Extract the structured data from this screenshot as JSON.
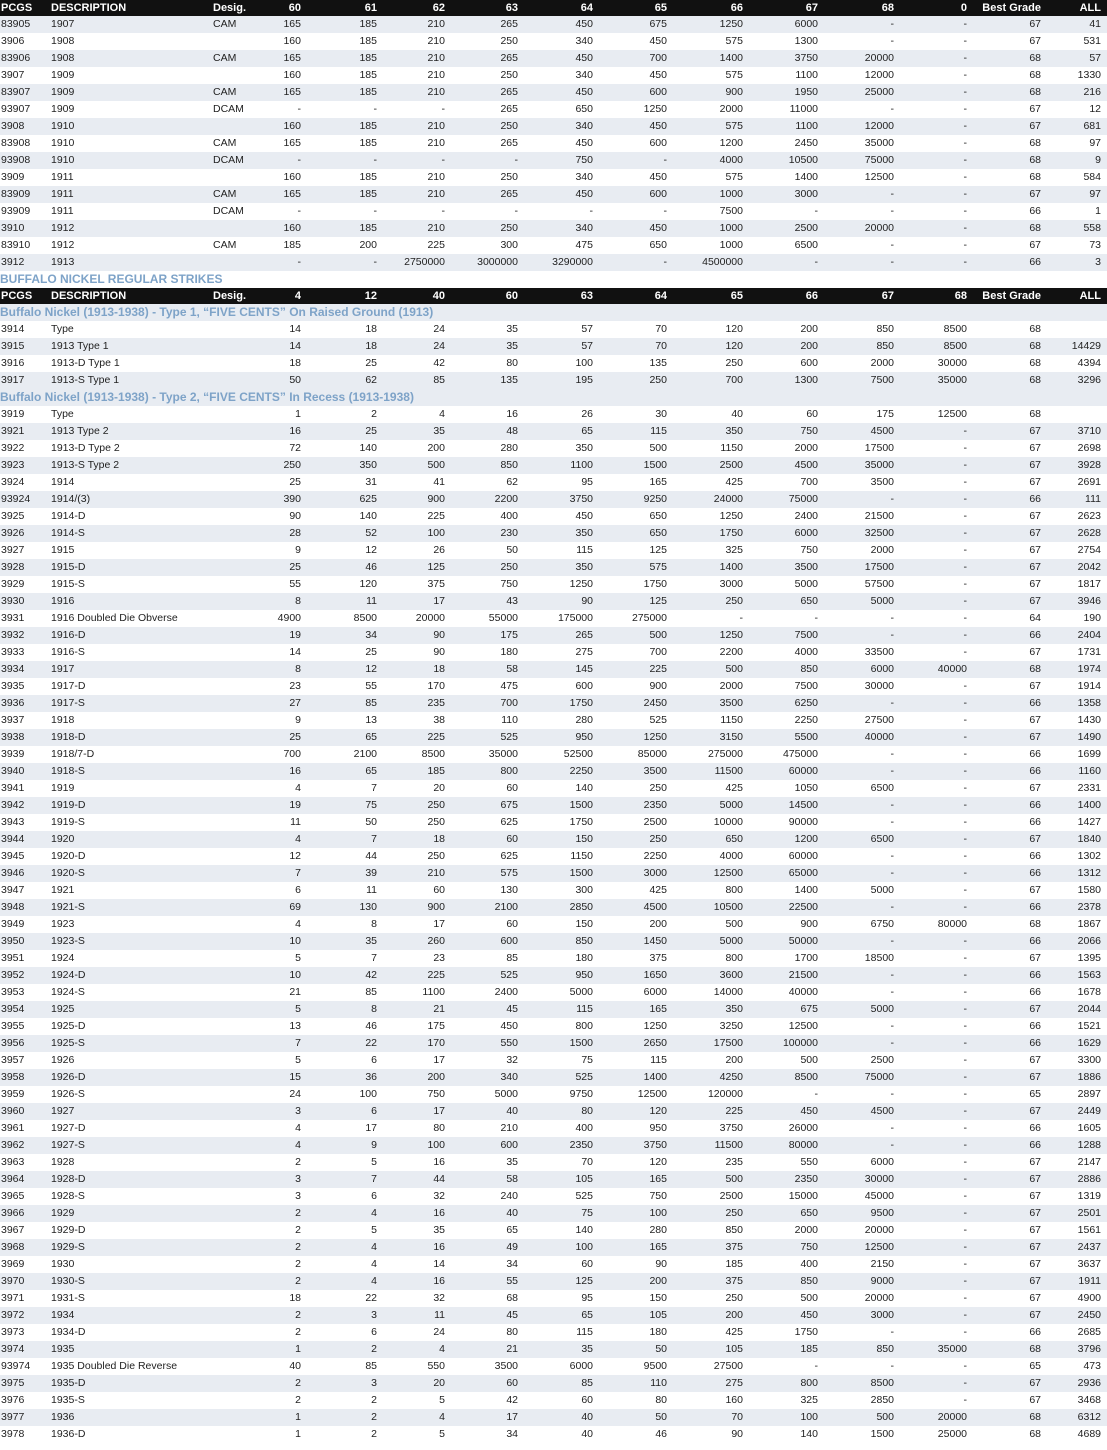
{
  "header1": {
    "pcgs": "PCGS",
    "desc": "DESCRIPTION",
    "desig": "Desig.",
    "g": [
      "60",
      "61",
      "62",
      "63",
      "64",
      "65",
      "66",
      "67",
      "68",
      "0"
    ],
    "best": "Best Grade",
    "all": "ALL"
  },
  "rows1": [
    [
      "83905",
      "1907",
      "CAM",
      "165",
      "185",
      "210",
      "265",
      "450",
      "675",
      "1250",
      "6000",
      "-",
      "-",
      "67",
      "41"
    ],
    [
      "3906",
      "1908",
      "",
      "160",
      "185",
      "210",
      "250",
      "340",
      "450",
      "575",
      "1300",
      "-",
      "-",
      "67",
      "531"
    ],
    [
      "83906",
      "1908",
      "CAM",
      "165",
      "185",
      "210",
      "265",
      "450",
      "700",
      "1400",
      "3750",
      "20000",
      "-",
      "68",
      "57"
    ],
    [
      "3907",
      "1909",
      "",
      "160",
      "185",
      "210",
      "250",
      "340",
      "450",
      "575",
      "1100",
      "12000",
      "-",
      "68",
      "1330"
    ],
    [
      "83907",
      "1909",
      "CAM",
      "165",
      "185",
      "210",
      "265",
      "450",
      "600",
      "900",
      "1950",
      "25000",
      "-",
      "68",
      "216"
    ],
    [
      "93907",
      "1909",
      "DCAM",
      "-",
      "-",
      "-",
      "265",
      "650",
      "1250",
      "2000",
      "11000",
      "-",
      "-",
      "67",
      "12"
    ],
    [
      "3908",
      "1910",
      "",
      "160",
      "185",
      "210",
      "250",
      "340",
      "450",
      "575",
      "1100",
      "12000",
      "-",
      "67",
      "681"
    ],
    [
      "83908",
      "1910",
      "CAM",
      "165",
      "185",
      "210",
      "265",
      "450",
      "600",
      "1200",
      "2450",
      "35000",
      "-",
      "68",
      "97"
    ],
    [
      "93908",
      "1910",
      "DCAM",
      "-",
      "-",
      "-",
      "-",
      "750",
      "-",
      "4000",
      "10500",
      "75000",
      "-",
      "68",
      "9"
    ],
    [
      "3909",
      "1911",
      "",
      "160",
      "185",
      "210",
      "250",
      "340",
      "450",
      "575",
      "1400",
      "12500",
      "-",
      "68",
      "584"
    ],
    [
      "83909",
      "1911",
      "CAM",
      "165",
      "185",
      "210",
      "265",
      "450",
      "600",
      "1000",
      "3000",
      "-",
      "-",
      "67",
      "97"
    ],
    [
      "93909",
      "1911",
      "DCAM",
      "-",
      "-",
      "-",
      "-",
      "-",
      "-",
      "7500",
      "-",
      "-",
      "-",
      "66",
      "1"
    ],
    [
      "3910",
      "1912",
      "",
      "160",
      "185",
      "210",
      "250",
      "340",
      "450",
      "1000",
      "2500",
      "20000",
      "-",
      "68",
      "558"
    ],
    [
      "83910",
      "1912",
      "CAM",
      "185",
      "200",
      "225",
      "300",
      "475",
      "650",
      "1000",
      "6500",
      "-",
      "-",
      "67",
      "73"
    ],
    [
      "3912",
      "1913",
      "",
      "-",
      "-",
      "2750000",
      "3000000",
      "3290000",
      "-",
      "4500000",
      "-",
      "-",
      "-",
      "66",
      "3"
    ]
  ],
  "section_title": "BUFFALO NICKEL REGULAR STRIKES",
  "header2": {
    "pcgs": "PCGS",
    "desc": "DESCRIPTION",
    "desig": "Desig.",
    "g": [
      "4",
      "12",
      "40",
      "60",
      "63",
      "64",
      "65",
      "66",
      "67",
      "68"
    ],
    "best": "Best Grade",
    "all": "ALL"
  },
  "sub1": "Buffalo Nickel (1913-1938) - Type 1, “FIVE CENTS” On Raised Ground  (1913)",
  "rows2": [
    [
      "3914",
      "Type",
      "",
      "14",
      "18",
      "24",
      "35",
      "57",
      "70",
      "120",
      "200",
      "850",
      "8500",
      "68",
      ""
    ],
    [
      "3915",
      "1913  Type 1",
      "",
      "14",
      "18",
      "24",
      "35",
      "57",
      "70",
      "120",
      "200",
      "850",
      "8500",
      "68",
      "14429"
    ],
    [
      "3916",
      "1913-D  Type 1",
      "",
      "18",
      "25",
      "42",
      "80",
      "100",
      "135",
      "250",
      "600",
      "2000",
      "30000",
      "68",
      "4394"
    ],
    [
      "3917",
      "1913-S  Type 1",
      "",
      "50",
      "62",
      "85",
      "135",
      "195",
      "250",
      "700",
      "1300",
      "7500",
      "35000",
      "68",
      "3296"
    ]
  ],
  "sub2": "Buffalo Nickel (1913-1938) - Type 2, “FIVE CENTS” In Recess  (1913-1938)",
  "rows3": [
    [
      "3919",
      "Type",
      "",
      "1",
      "2",
      "4",
      "16",
      "26",
      "30",
      "40",
      "60",
      "175",
      "12500",
      "68",
      ""
    ],
    [
      "3921",
      "1913  Type 2",
      "",
      "16",
      "25",
      "35",
      "48",
      "65",
      "115",
      "350",
      "750",
      "4500",
      "-",
      "67",
      "3710"
    ],
    [
      "3922",
      "1913-D  Type 2",
      "",
      "72",
      "140",
      "200",
      "280",
      "350",
      "500",
      "1150",
      "2000",
      "17500",
      "-",
      "67",
      "2698"
    ],
    [
      "3923",
      "1913-S  Type 2",
      "",
      "250",
      "350",
      "500",
      "850",
      "1100",
      "1500",
      "2500",
      "4500",
      "35000",
      "-",
      "67",
      "3928"
    ],
    [
      "3924",
      "1914",
      "",
      "25",
      "31",
      "41",
      "62",
      "95",
      "165",
      "425",
      "700",
      "3500",
      "-",
      "67",
      "2691"
    ],
    [
      "93924",
      "1914/(3)",
      "",
      "390",
      "625",
      "900",
      "2200",
      "3750",
      "9250",
      "24000",
      "75000",
      "-",
      "-",
      "66",
      "111"
    ],
    [
      "3925",
      "1914-D",
      "",
      "90",
      "140",
      "225",
      "400",
      "450",
      "650",
      "1250",
      "2400",
      "21500",
      "-",
      "67",
      "2623"
    ],
    [
      "3926",
      "1914-S",
      "",
      "28",
      "52",
      "100",
      "230",
      "350",
      "650",
      "1750",
      "6000",
      "32500",
      "-",
      "67",
      "2628"
    ],
    [
      "3927",
      "1915",
      "",
      "9",
      "12",
      "26",
      "50",
      "115",
      "125",
      "325",
      "750",
      "2000",
      "-",
      "67",
      "2754"
    ],
    [
      "3928",
      "1915-D",
      "",
      "25",
      "46",
      "125",
      "250",
      "350",
      "575",
      "1400",
      "3500",
      "17500",
      "-",
      "67",
      "2042"
    ],
    [
      "3929",
      "1915-S",
      "",
      "55",
      "120",
      "375",
      "750",
      "1250",
      "1750",
      "3000",
      "5000",
      "57500",
      "-",
      "67",
      "1817"
    ],
    [
      "3930",
      "1916",
      "",
      "8",
      "11",
      "17",
      "43",
      "90",
      "125",
      "250",
      "650",
      "5000",
      "-",
      "67",
      "3946"
    ],
    [
      "3931",
      "1916  Doubled Die Obverse",
      "",
      "4900",
      "8500",
      "20000",
      "55000",
      "175000",
      "275000",
      "-",
      "-",
      "-",
      "-",
      "64",
      "190"
    ],
    [
      "3932",
      "1916-D",
      "",
      "19",
      "34",
      "90",
      "175",
      "265",
      "500",
      "1250",
      "7500",
      "-",
      "-",
      "66",
      "2404"
    ],
    [
      "3933",
      "1916-S",
      "",
      "14",
      "25",
      "90",
      "180",
      "275",
      "700",
      "2200",
      "4000",
      "33500",
      "-",
      "67",
      "1731"
    ],
    [
      "3934",
      "1917",
      "",
      "8",
      "12",
      "18",
      "58",
      "145",
      "225",
      "500",
      "850",
      "6000",
      "40000",
      "68",
      "1974"
    ],
    [
      "3935",
      "1917-D",
      "",
      "23",
      "55",
      "170",
      "475",
      "600",
      "900",
      "2000",
      "7500",
      "30000",
      "-",
      "67",
      "1914"
    ],
    [
      "3936",
      "1917-S",
      "",
      "27",
      "85",
      "235",
      "700",
      "1750",
      "2450",
      "3500",
      "6250",
      "-",
      "-",
      "66",
      "1358"
    ],
    [
      "3937",
      "1918",
      "",
      "9",
      "13",
      "38",
      "110",
      "280",
      "525",
      "1150",
      "2250",
      "27500",
      "-",
      "67",
      "1430"
    ],
    [
      "3938",
      "1918-D",
      "",
      "25",
      "65",
      "225",
      "525",
      "950",
      "1250",
      "3150",
      "5500",
      "40000",
      "-",
      "67",
      "1490"
    ],
    [
      "3939",
      "1918/7-D",
      "",
      "700",
      "2100",
      "8500",
      "35000",
      "52500",
      "85000",
      "275000",
      "475000",
      "-",
      "-",
      "66",
      "1699"
    ],
    [
      "3940",
      "1918-S",
      "",
      "16",
      "65",
      "185",
      "800",
      "2250",
      "3500",
      "11500",
      "60000",
      "-",
      "-",
      "66",
      "1160"
    ],
    [
      "3941",
      "1919",
      "",
      "4",
      "7",
      "20",
      "60",
      "140",
      "250",
      "425",
      "1050",
      "6500",
      "-",
      "67",
      "2331"
    ],
    [
      "3942",
      "1919-D",
      "",
      "19",
      "75",
      "250",
      "675",
      "1500",
      "2350",
      "5000",
      "14500",
      "-",
      "-",
      "66",
      "1400"
    ],
    [
      "3943",
      "1919-S",
      "",
      "11",
      "50",
      "250",
      "625",
      "1750",
      "2500",
      "10000",
      "90000",
      "-",
      "-",
      "66",
      "1427"
    ],
    [
      "3944",
      "1920",
      "",
      "4",
      "7",
      "18",
      "60",
      "150",
      "250",
      "650",
      "1200",
      "6500",
      "-",
      "67",
      "1840"
    ],
    [
      "3945",
      "1920-D",
      "",
      "12",
      "44",
      "250",
      "625",
      "1150",
      "2250",
      "4000",
      "60000",
      "-",
      "-",
      "66",
      "1302"
    ],
    [
      "3946",
      "1920-S",
      "",
      "7",
      "39",
      "210",
      "575",
      "1500",
      "3000",
      "12500",
      "65000",
      "-",
      "-",
      "66",
      "1312"
    ],
    [
      "3947",
      "1921",
      "",
      "6",
      "11",
      "60",
      "130",
      "300",
      "425",
      "800",
      "1400",
      "5000",
      "-",
      "67",
      "1580"
    ],
    [
      "3948",
      "1921-S",
      "",
      "69",
      "130",
      "900",
      "2100",
      "2850",
      "4500",
      "10500",
      "22500",
      "-",
      "-",
      "66",
      "2378"
    ],
    [
      "3949",
      "1923",
      "",
      "4",
      "8",
      "17",
      "60",
      "150",
      "200",
      "500",
      "900",
      "6750",
      "80000",
      "68",
      "1867"
    ],
    [
      "3950",
      "1923-S",
      "",
      "10",
      "35",
      "260",
      "600",
      "850",
      "1450",
      "5000",
      "50000",
      "-",
      "-",
      "66",
      "2066"
    ],
    [
      "3951",
      "1924",
      "",
      "5",
      "7",
      "23",
      "85",
      "180",
      "375",
      "800",
      "1700",
      "18500",
      "-",
      "67",
      "1395"
    ],
    [
      "3952",
      "1924-D",
      "",
      "10",
      "42",
      "225",
      "525",
      "950",
      "1650",
      "3600",
      "21500",
      "-",
      "-",
      "66",
      "1563"
    ],
    [
      "3953",
      "1924-S",
      "",
      "21",
      "85",
      "1100",
      "2400",
      "5000",
      "6000",
      "14000",
      "40000",
      "-",
      "-",
      "66",
      "1678"
    ],
    [
      "3954",
      "1925",
      "",
      "5",
      "8",
      "21",
      "45",
      "115",
      "165",
      "350",
      "675",
      "5000",
      "-",
      "67",
      "2044"
    ],
    [
      "3955",
      "1925-D",
      "",
      "13",
      "46",
      "175",
      "450",
      "800",
      "1250",
      "3250",
      "12500",
      "-",
      "-",
      "66",
      "1521"
    ],
    [
      "3956",
      "1925-S",
      "",
      "7",
      "22",
      "170",
      "550",
      "1500",
      "2650",
      "17500",
      "100000",
      "-",
      "-",
      "66",
      "1629"
    ],
    [
      "3957",
      "1926",
      "",
      "5",
      "6",
      "17",
      "32",
      "75",
      "115",
      "200",
      "500",
      "2500",
      "-",
      "67",
      "3300"
    ],
    [
      "3958",
      "1926-D",
      "",
      "15",
      "36",
      "200",
      "340",
      "525",
      "1400",
      "4250",
      "8500",
      "75000",
      "-",
      "67",
      "1886"
    ],
    [
      "3959",
      "1926-S",
      "",
      "24",
      "100",
      "750",
      "5000",
      "9750",
      "12500",
      "120000",
      "-",
      "-",
      "-",
      "65",
      "2897"
    ],
    [
      "3960",
      "1927",
      "",
      "3",
      "6",
      "17",
      "40",
      "80",
      "120",
      "225",
      "450",
      "4500",
      "-",
      "67",
      "2449"
    ],
    [
      "3961",
      "1927-D",
      "",
      "4",
      "17",
      "80",
      "210",
      "400",
      "950",
      "3750",
      "26000",
      "-",
      "-",
      "66",
      "1605"
    ],
    [
      "3962",
      "1927-S",
      "",
      "4",
      "9",
      "100",
      "600",
      "2350",
      "3750",
      "11500",
      "80000",
      "-",
      "-",
      "66",
      "1288"
    ],
    [
      "3963",
      "1928",
      "",
      "2",
      "5",
      "16",
      "35",
      "70",
      "120",
      "235",
      "550",
      "6000",
      "-",
      "67",
      "2147"
    ],
    [
      "3964",
      "1928-D",
      "",
      "3",
      "7",
      "44",
      "58",
      "105",
      "165",
      "500",
      "2350",
      "30000",
      "-",
      "67",
      "2886"
    ],
    [
      "3965",
      "1928-S",
      "",
      "3",
      "6",
      "32",
      "240",
      "525",
      "750",
      "2500",
      "15000",
      "45000",
      "-",
      "67",
      "1319"
    ],
    [
      "3966",
      "1929",
      "",
      "2",
      "4",
      "16",
      "40",
      "75",
      "100",
      "250",
      "650",
      "9500",
      "-",
      "67",
      "2501"
    ],
    [
      "3967",
      "1929-D",
      "",
      "2",
      "5",
      "35",
      "65",
      "140",
      "280",
      "850",
      "2000",
      "20000",
      "-",
      "67",
      "1561"
    ],
    [
      "3968",
      "1929-S",
      "",
      "2",
      "4",
      "16",
      "49",
      "100",
      "165",
      "375",
      "750",
      "12500",
      "-",
      "67",
      "2437"
    ],
    [
      "3969",
      "1930",
      "",
      "2",
      "4",
      "14",
      "34",
      "60",
      "90",
      "185",
      "400",
      "2150",
      "-",
      "67",
      "3637"
    ],
    [
      "3970",
      "1930-S",
      "",
      "2",
      "4",
      "16",
      "55",
      "125",
      "200",
      "375",
      "850",
      "9000",
      "-",
      "67",
      "1911"
    ],
    [
      "3971",
      "1931-S",
      "",
      "18",
      "22",
      "32",
      "68",
      "95",
      "150",
      "250",
      "500",
      "20000",
      "-",
      "67",
      "4900"
    ],
    [
      "3972",
      "1934",
      "",
      "2",
      "3",
      "11",
      "45",
      "65",
      "105",
      "200",
      "450",
      "3000",
      "-",
      "67",
      "2450"
    ],
    [
      "3973",
      "1934-D",
      "",
      "2",
      "6",
      "24",
      "80",
      "115",
      "180",
      "425",
      "1750",
      "-",
      "-",
      "66",
      "2685"
    ],
    [
      "3974",
      "1935",
      "",
      "1",
      "2",
      "4",
      "21",
      "35",
      "50",
      "105",
      "185",
      "850",
      "35000",
      "68",
      "3796"
    ],
    [
      "93974",
      "1935  Doubled Die Reverse",
      "",
      "40",
      "85",
      "550",
      "3500",
      "6000",
      "9500",
      "27500",
      "-",
      "-",
      "-",
      "65",
      "473"
    ],
    [
      "3975",
      "1935-D",
      "",
      "2",
      "3",
      "20",
      "60",
      "85",
      "110",
      "275",
      "800",
      "8500",
      "-",
      "67",
      "2936"
    ],
    [
      "3976",
      "1935-S",
      "",
      "2",
      "2",
      "5",
      "42",
      "60",
      "80",
      "160",
      "325",
      "2850",
      "-",
      "67",
      "3468"
    ],
    [
      "3977",
      "1936",
      "",
      "1",
      "2",
      "4",
      "17",
      "40",
      "50",
      "70",
      "100",
      "500",
      "20000",
      "68",
      "6312"
    ],
    [
      "3978",
      "1936-D",
      "",
      "1",
      "2",
      "5",
      "34",
      "40",
      "46",
      "90",
      "140",
      "1500",
      "25000",
      "68",
      "4689"
    ]
  ]
}
